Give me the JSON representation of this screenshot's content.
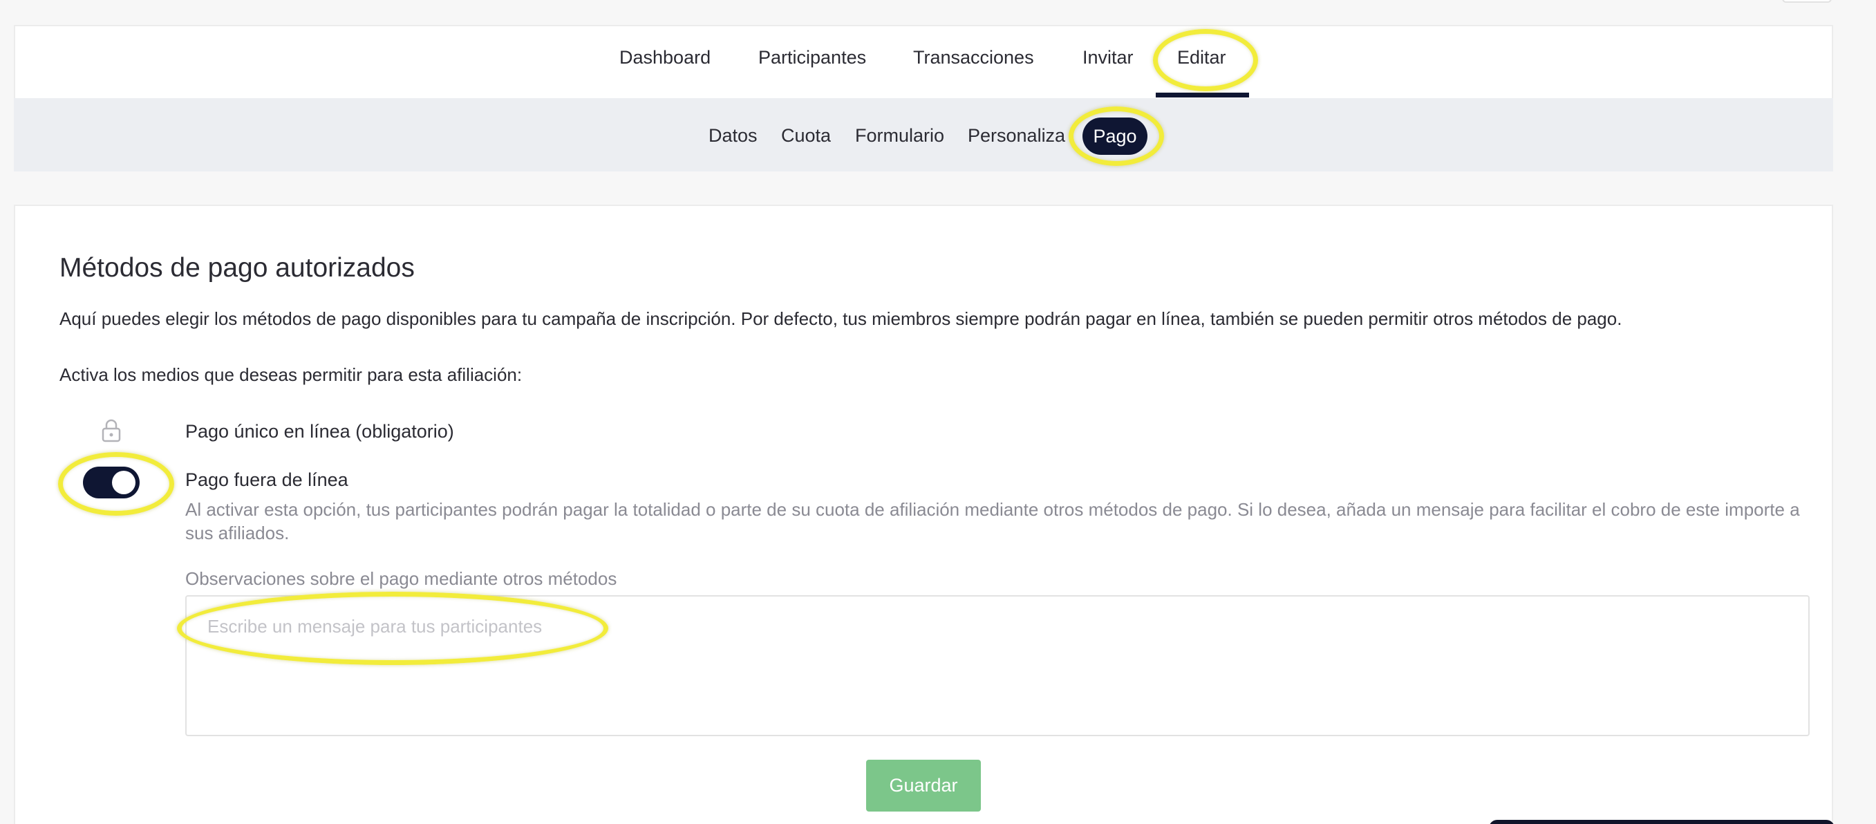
{
  "main_nav": {
    "tabs": [
      {
        "label": "Dashboard"
      },
      {
        "label": "Participantes"
      },
      {
        "label": "Transacciones"
      },
      {
        "label": "Invitar"
      },
      {
        "label": "Editar",
        "active": true
      }
    ]
  },
  "sub_nav": {
    "items": [
      {
        "label": "Datos"
      },
      {
        "label": "Cuota"
      },
      {
        "label": "Formulario"
      },
      {
        "label": "Personaliza"
      },
      {
        "label": "Pago",
        "active": true
      }
    ]
  },
  "payment": {
    "title": "Métodos de pago autorizados",
    "intro": "Aquí puedes elegir los métodos de pago disponibles para tu campaña de inscripción. Por defecto, tus miembros siempre podrán pagar en línea, también se pueden permitir otros métodos de pago.",
    "activate_prompt": "Activa los medios que deseas permitir para esta afiliación:",
    "online_option": {
      "label": "Pago único en línea (obligatorio)",
      "icon": "lock-icon"
    },
    "offline_option": {
      "label": "Pago fuera de línea",
      "enabled": true,
      "help": "Al activar esta opción, tus participantes podrán pagar la totalidad o parte de su cuota de afiliación mediante otros métodos de pago. Si lo desea, añada un mensaje para facilitar el cobro de este importe a sus afiliados."
    },
    "observations": {
      "label": "Observaciones sobre el pago mediante otros métodos",
      "placeholder": "Escribe un mensaje para tus participantes",
      "value": ""
    },
    "save_label": "Guardar"
  },
  "colors": {
    "accent_dark": "#0f1633",
    "save_green": "#7cc68a",
    "highlight_yellow": "#f2ec3b"
  }
}
